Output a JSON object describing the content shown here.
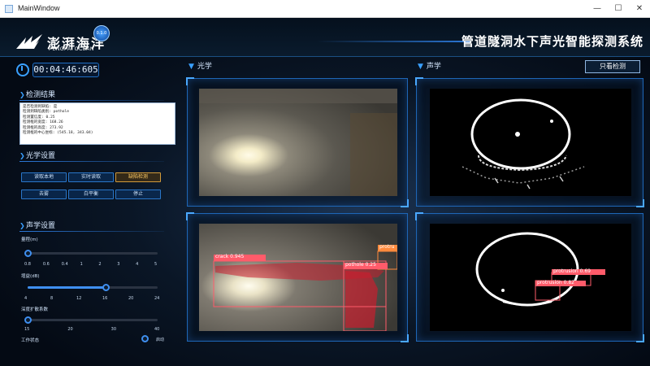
{
  "window": {
    "title": "MainWindow",
    "minimize": "—",
    "maximize": "☐",
    "close": "✕"
  },
  "brand": {
    "name_cn": "澎湃海洋",
    "name_en": "PENGPAI OCEAN",
    "badge": "0.1.0"
  },
  "app_title": "管道隧洞水下声光智能探测系统",
  "timer": "00:04:46:605",
  "detection": {
    "heading": "检测结果",
    "lines": [
      "是否检测到缺陷: 是",
      "检测到缺陷类别: pothole",
      "检测置信度: 0.25",
      "检测框的宽度: 168.26",
      "检测框的高度: 273.92",
      "检测框的中心坐标: (545.18, 343.04)"
    ]
  },
  "optical_settings": {
    "heading": "光学设置",
    "buttons": [
      "读取本地",
      "实时读取",
      "缺陷检测",
      "去雾",
      "白平衡",
      "停止"
    ],
    "active": 2
  },
  "acoustic_settings": {
    "heading": "声学设置",
    "range": {
      "label": "量程(m)",
      "ticks": [
        "0.8",
        "0.6",
        "0.4",
        "1",
        "2",
        "3",
        "4",
        "5"
      ],
      "value_fraction": 0.0
    },
    "gain": {
      "label": "增益(dB)",
      "ticks": [
        "4",
        "8",
        "12",
        "16",
        "20",
        "24"
      ],
      "value_fraction": 0.6
    },
    "spread": {
      "label": "深度扩散系数",
      "ticks": [
        "15",
        "20",
        "30",
        "40"
      ],
      "value_fraction": 0.0
    },
    "status": {
      "label": "工作状态",
      "value": "启动"
    }
  },
  "views": {
    "optical_label": "光学",
    "acoustic_label": "声学",
    "only_detect_button": "只看检测",
    "optical_detections": [
      {
        "label": "crack 0.945",
        "color": "#ff5b6a"
      },
      {
        "label": "pothole 0.25",
        "color": "#ff5b6a"
      },
      {
        "label": "protru",
        "color": "#ff8a3d"
      }
    ],
    "acoustic_detections": [
      {
        "label": "protrusion 0.69",
        "color": "#ff5b6a"
      },
      {
        "label": "protrusion 0.82",
        "color": "#ff5b6a"
      }
    ]
  },
  "colors": {
    "accent": "#2b78d8",
    "panel_border": "#1e66b6",
    "active_button": "#d19a3a",
    "detection_red": "#ff5b6a"
  }
}
